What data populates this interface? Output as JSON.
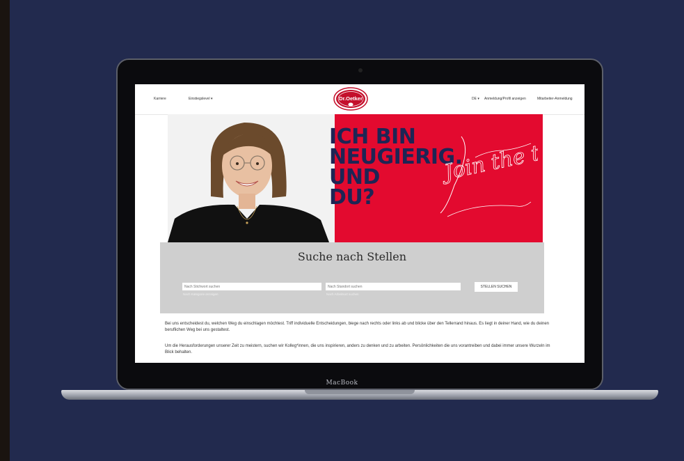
{
  "device": {
    "brand": "MacBook"
  },
  "site": {
    "nav": {
      "left_items": [
        {
          "label": "Karriere"
        },
        {
          "label": "Einstiegslevel",
          "chevron": true
        }
      ],
      "logo_text": "Dr.Oetker",
      "right_items": [
        {
          "label": "DE",
          "chevron": true
        },
        {
          "label": "Anmeldung/Profil anzeigen"
        },
        {
          "label": "Mitarbeiter-Anmeldung"
        }
      ]
    },
    "hero": {
      "headline_lines": [
        "ICH BIN",
        "NEUGIERIG.",
        "UND",
        "DU?"
      ],
      "script_text": "Join the taste."
    },
    "search": {
      "title": "Suche nach Stellen",
      "keyword_placeholder": "Nach Stichwort suchen",
      "keyword_helper": "Nach Kategorie anzeigen",
      "location_placeholder": "Nach Standort suchen",
      "location_helper": "Nach Arbeitsort suchen",
      "submit_label": "STELLEN SUCHEN"
    },
    "intro": {
      "paragraph_1": "Bei uns entscheidest du, welchen Weg du einschlagen möchtest. Triff individuelle Entscheidungen, biege nach rechts oder links ab und blicke über den Tellerrand hinaus. Es liegt in deiner Hand, wie du deinen beruflichen Weg bei uns gestaltest.",
      "paragraph_2": "Um die Herausforderungen unserer Zeit zu meistern, suchen wir Kolleg*innen, die uns inspirieren, anders zu denken und zu arbeiten. Persönlichkeiten die uns vorantreiben und dabei immer unsere Wurzeln im Blick behalten."
    }
  },
  "colors": {
    "background": "#222a4e",
    "hero_red": "#e30a2f",
    "headline_navy": "#1e2555",
    "search_panel": "#cfcfcf"
  }
}
